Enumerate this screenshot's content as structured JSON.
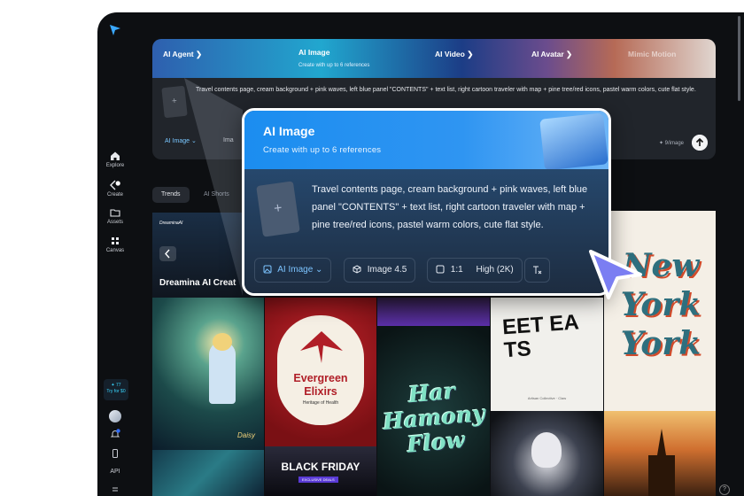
{
  "sidebar": {
    "items": [
      {
        "label": "Explore",
        "icon": "home-icon"
      },
      {
        "label": "Create",
        "icon": "create-icon",
        "badge": "1"
      },
      {
        "label": "Assets",
        "icon": "folder-icon"
      },
      {
        "label": "Canvas",
        "icon": "canvas-icon"
      }
    ],
    "promo_line1": "✦ 77",
    "promo_line2": "Try for $0",
    "notification_badge": "2",
    "api_label": "API"
  },
  "banner": {
    "tabs": [
      {
        "label": "AI Agent ❯"
      },
      {
        "label": "AI Image"
      },
      {
        "label": "AI Video ❯"
      },
      {
        "label": "AI Avatar ❯"
      },
      {
        "label": "Mimic Motion"
      }
    ],
    "active_sub": "Create with up to 6 references"
  },
  "prompt": {
    "text": "Travel contents page, cream background + pink waves, left blue panel \"CONTENTS\" + text list, right cartoon traveler with map + pine tree/red icons, pastel warm colors, cute flat style.",
    "thumb_plus": "+",
    "mode_chip": "AI Image ⌄",
    "model_chip": "Ima",
    "cost": "✦ 9/image"
  },
  "feed_tabs": [
    {
      "label": "Trends"
    },
    {
      "label": "AI Shorts"
    }
  ],
  "hero": {
    "brand": "DreaminaAI",
    "title": "Dreamina AI Creat"
  },
  "gallery": {
    "fairy_caption": "Daisy",
    "evergreen_line1": "Evergreen",
    "evergreen_line2": "Elixirs",
    "evergreen_sub": "Heritage of Health",
    "blackfriday_title": "BLACK FRIDAY",
    "blackfriday_sub": "EXCLUSIVE DEALS",
    "flow_text": "Har Hamony Flow",
    "eat_text": "EET EA TS",
    "eat_sub": "Artisan Collective · Claw",
    "ny_text": "New York York"
  },
  "popup": {
    "title": "AI Image",
    "subtitle": "Create with up to 6 references",
    "prompt": "Travel contents page, cream background + pink waves, left blue panel \"CONTENTS\" + text list, right cartoon traveler with map + pine tree/red icons, pastel warm colors,  cute flat style.",
    "thumb_plus": "+",
    "chips": {
      "mode": "AI Image",
      "model": "Image 4.5",
      "ratio": "1:1",
      "quality": "High (2K)"
    }
  },
  "help_label": "?",
  "colors": {
    "app_bg": "#0d0f12",
    "accent_blue": "#1b8df0",
    "popup_body": "#26486d",
    "cursor": "#8a8cf5"
  }
}
